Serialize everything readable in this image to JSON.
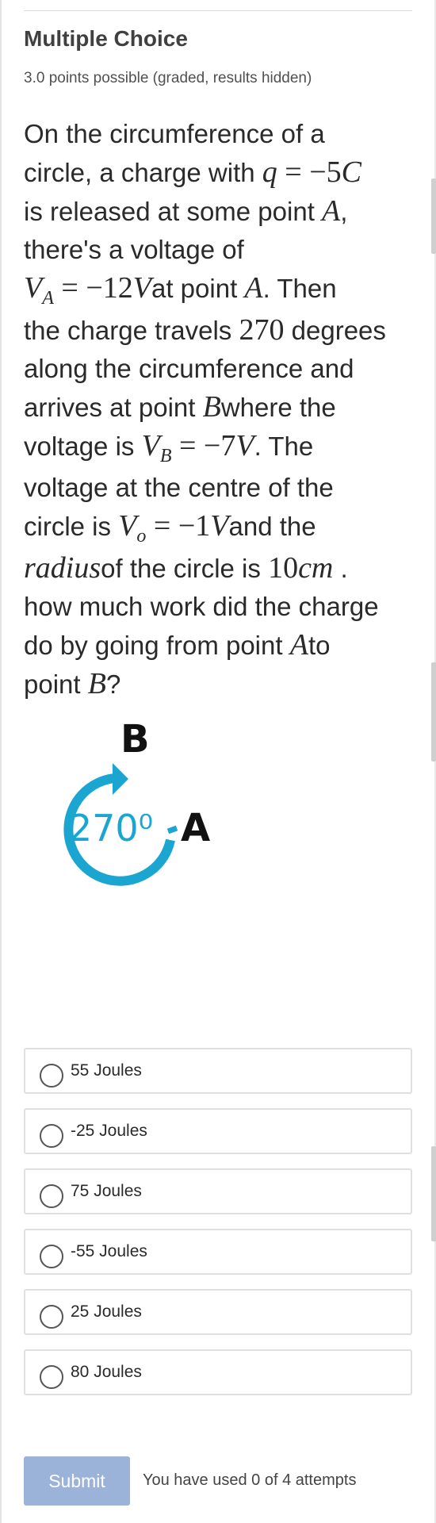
{
  "header": {
    "title": "Multiple Choice",
    "points": "3.0 points possible (graded, results hidden)"
  },
  "question": {
    "l1_text": "On the circumference of a",
    "l2_text": "circle, a charge with",
    "l2_q": "q",
    "l2_eq": " = −5",
    "l2_c": "C",
    "l3_text_a": "is released at some point",
    "l3_a": "A",
    "l3_text_b": ",",
    "l4_text": "there's a voltage of",
    "l5_v": "V",
    "l5_sub": "A",
    "l5_eq": " = −12",
    "l5_unit": "V",
    "l5_text_a": "at point",
    "l5_a": "A",
    "l5_text_b": ". Then",
    "l6_text_a": "the charge travels",
    "l6_num": "270",
    "l6_text_b": " degrees",
    "l7_text": "along the circumference and",
    "l8_text_a": "arrives at point",
    "l8_b": "B",
    "l8_text_b": "where the",
    "l9_text_a": "voltage is",
    "l9_v": "V",
    "l9_sub": "B",
    "l9_eq": " = −7",
    "l9_unit": "V",
    "l9_text_b": ". The",
    "l10_text": "voltage at the centre of the",
    "l11_text_a": "circle is",
    "l11_v": "V",
    "l11_sub": "o",
    "l11_eq": " = −1",
    "l11_unit": "V",
    "l11_text_b": "and the",
    "l12_radius": "radius",
    "l12_text_a": "of the circle is",
    "l12_num": "10",
    "l12_unit": "cm",
    "l12_text_b": " .",
    "l13_text": "how much work did the charge",
    "l14_text_a": "do by going from point",
    "l14_a": "A",
    "l14_text_b": "to",
    "l15_text_a": "point",
    "l15_b": "B",
    "l15_text_b": "?"
  },
  "diagram": {
    "label_b": "B",
    "label_a": "A",
    "angle": "270⁰",
    "arc_color": "#1aa6d1"
  },
  "options": [
    {
      "label": "55 Joules"
    },
    {
      "label": "-25 Joules"
    },
    {
      "label": "75 Joules"
    },
    {
      "label": "-55 Joules"
    },
    {
      "label": "25 Joules"
    },
    {
      "label": "80 Joules"
    }
  ],
  "footer": {
    "submit_label": "Submit",
    "attempts_text": "You have used 0 of 4 attempts"
  },
  "colors": {
    "submit_bg": "#9cb3d9",
    "accent": "#1aa6d1"
  }
}
